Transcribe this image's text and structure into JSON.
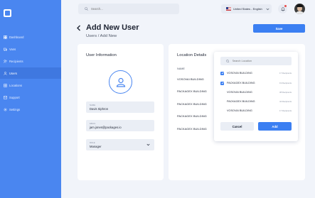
{
  "sidebar": {
    "items": [
      {
        "label": "Dashboard",
        "icon": "dashboard-icon",
        "active": false
      },
      {
        "label": "Vans",
        "icon": "van-icon",
        "active": false
      },
      {
        "label": "Recipients",
        "icon": "recipients-icon",
        "active": false
      },
      {
        "label": "Users",
        "icon": "user-icon",
        "active": true
      },
      {
        "label": "Locations",
        "icon": "location-icon",
        "active": false
      },
      {
        "label": "Support",
        "icon": "support-icon",
        "active": false
      },
      {
        "label": "Settings",
        "icon": "gear-icon",
        "active": false
      }
    ]
  },
  "topbar": {
    "search_placeholder": "Search...",
    "language": "United States - English"
  },
  "header": {
    "title": "Add New User",
    "breadcrumb": "Users / Add New",
    "save_label": "Save"
  },
  "user_info": {
    "title": "User Information",
    "name_label": "NAME",
    "name_value": "Davis Siphron",
    "email_label": "EMAIL",
    "email_value": "jam.jones@packages.io",
    "role_label": "ROLE",
    "role_value": "Manager"
  },
  "location_details": {
    "title": "Location Details",
    "column_name": "NAME",
    "rows": [
      "VOSOVAI BUILDING",
      "PACKAGEX BUILDING",
      "PACKAGEX BUILDING",
      "PACKAGEX BUILDING",
      "PACKAGEX BUILDING"
    ]
  },
  "location_picker": {
    "search_placeholder": "Search Location",
    "options": [
      {
        "name": "VOSOVAI BUILDING",
        "count": "17 Recipients",
        "checked": true
      },
      {
        "name": "PACKAGEX BUILDING",
        "count": "19 Recipients",
        "checked": true
      },
      {
        "name": "VOSOVAI BUILDING",
        "count": "38 Recipients",
        "checked": false
      },
      {
        "name": "PACKAGEX BUILDING",
        "count": "44 Recipients",
        "checked": false
      },
      {
        "name": "VOSOVAI BUILDING",
        "count": "17 Recipients",
        "checked": false
      }
    ],
    "cancel_label": "Cancel",
    "add_label": "Add"
  },
  "colors": {
    "sidebar": "#4a86f0",
    "accent": "#3b7ff2",
    "background": "#f1f4fa"
  }
}
